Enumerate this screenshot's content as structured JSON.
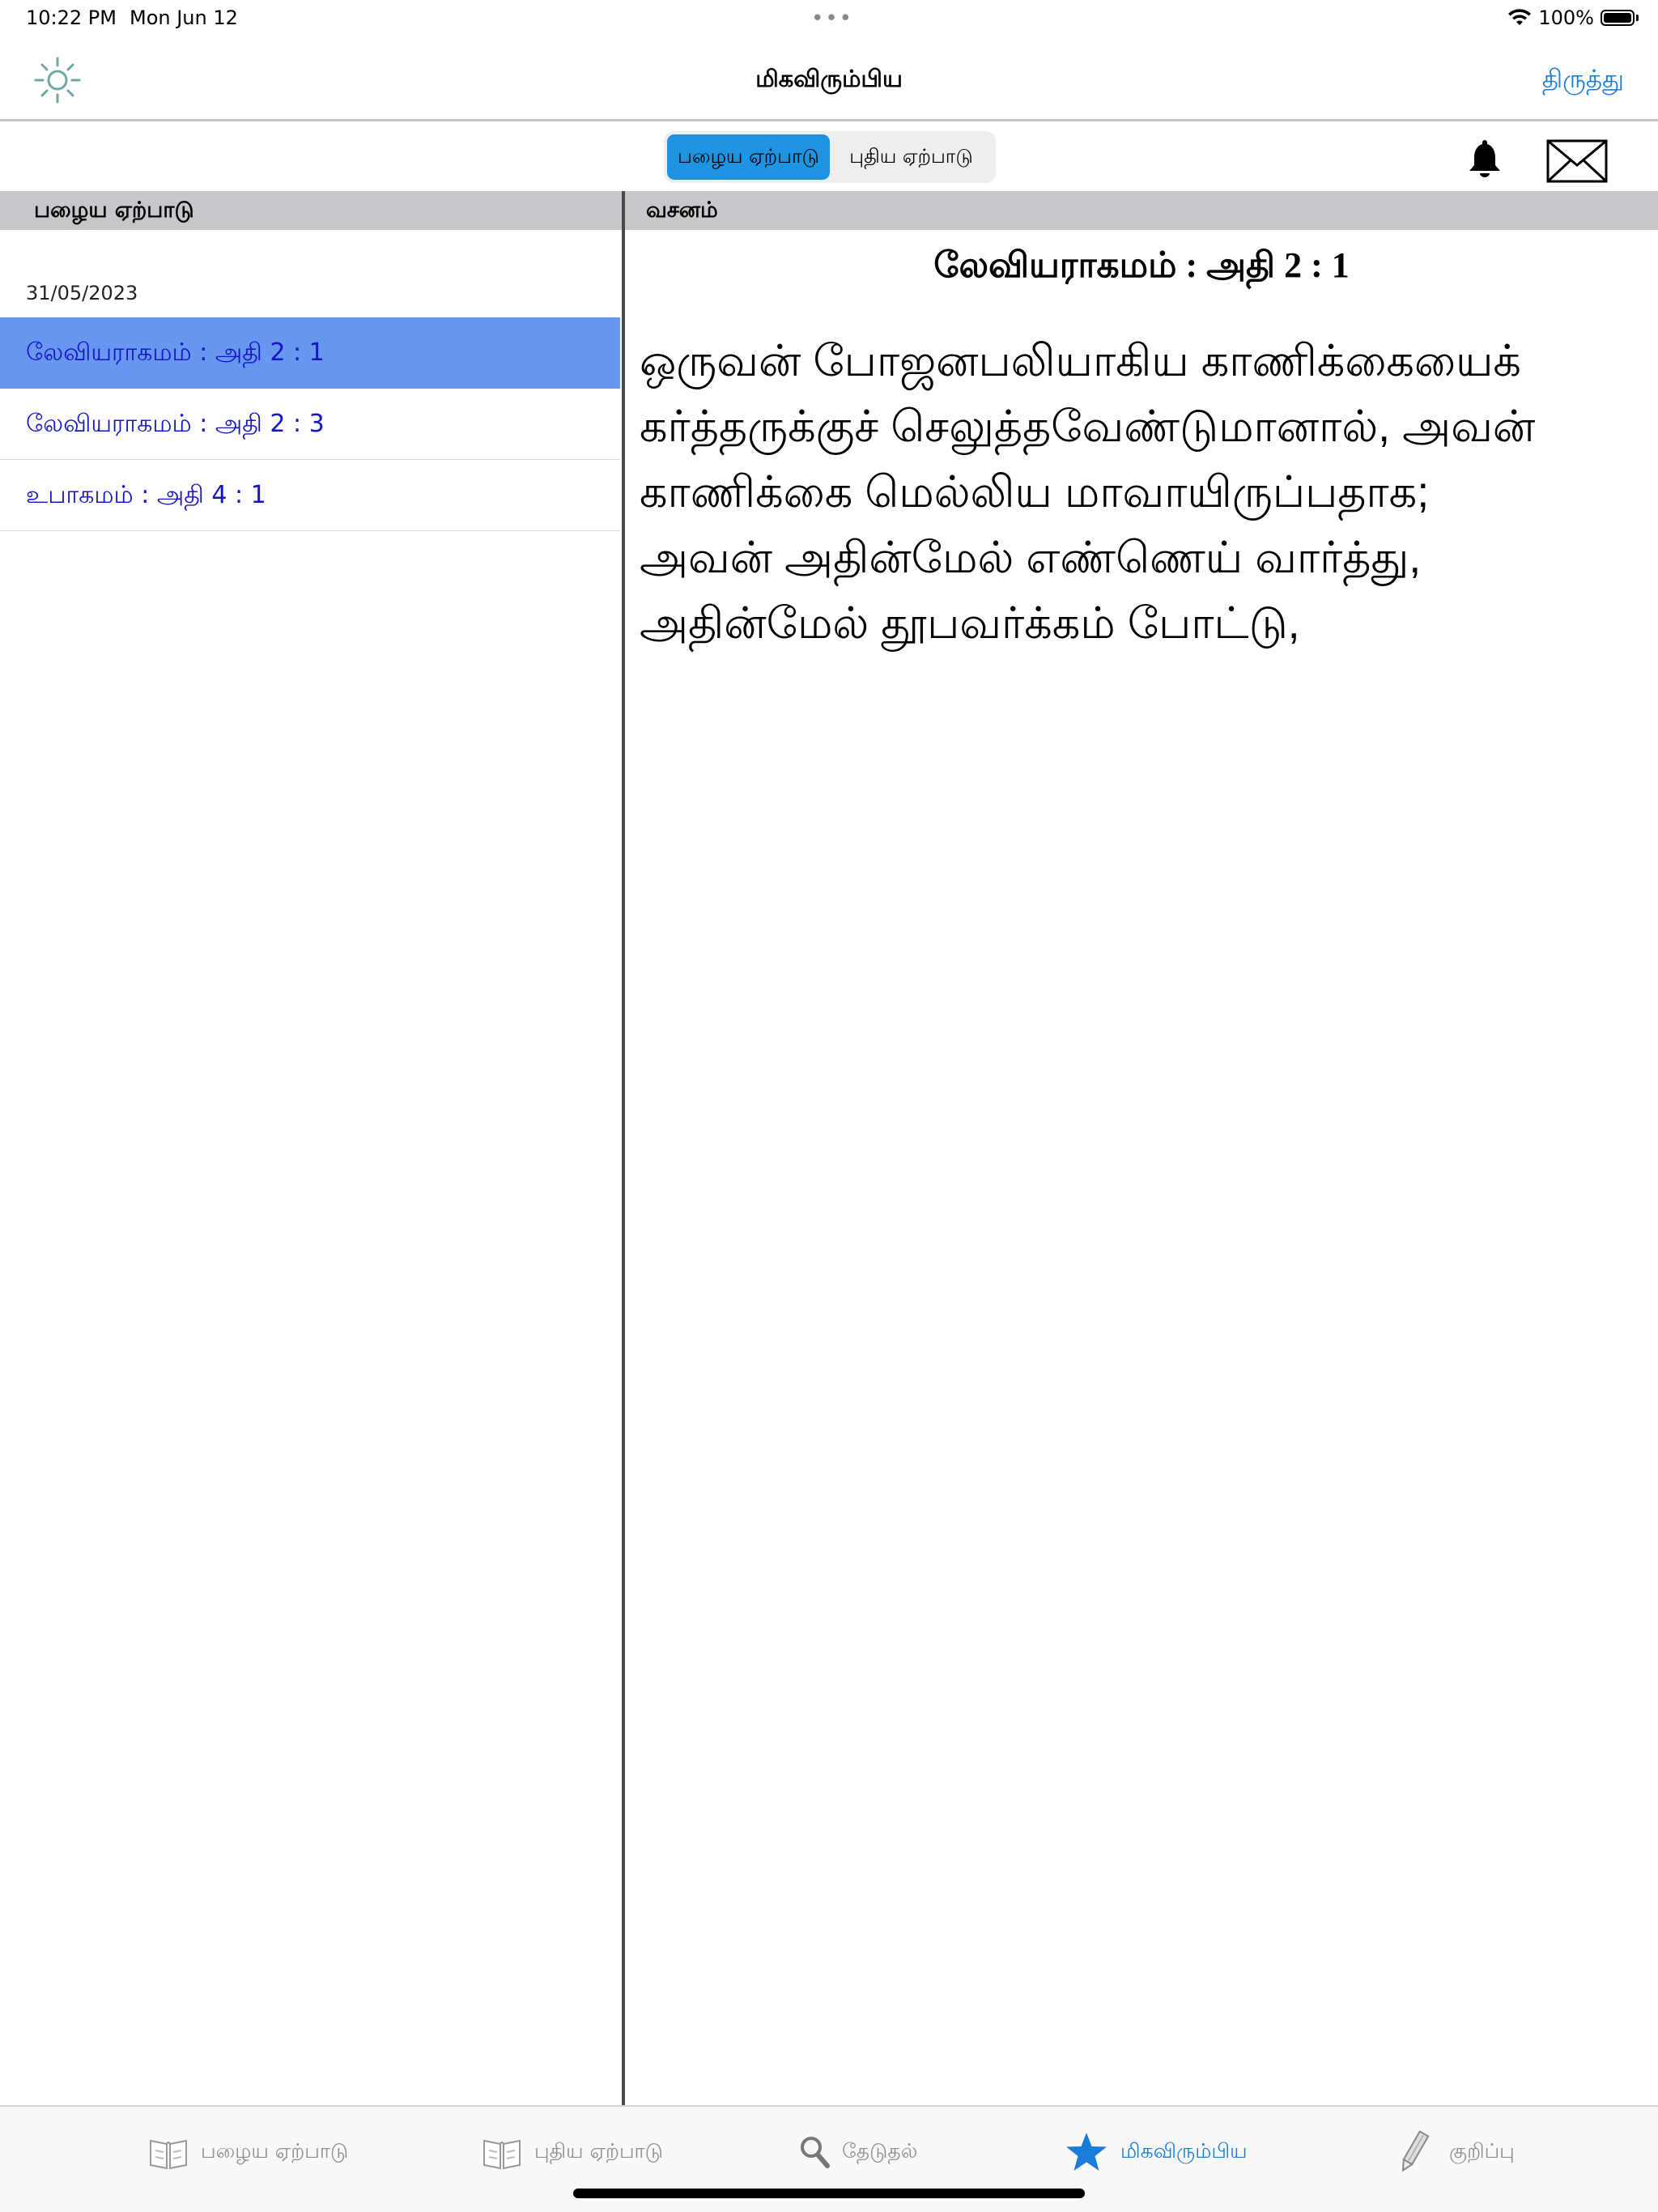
{
  "status_bar": {
    "time": "10:22 PM",
    "date": "Mon Jun 12",
    "dots": "•••",
    "battery_percent": "100%",
    "battery_level": 1.0
  },
  "nav": {
    "title": "மிகவிரும்பிய",
    "edit_label": "திருத்து"
  },
  "segments": {
    "old": "பழைய ஏற்பாடு",
    "new": "புதிய ஏற்பாடு",
    "selected": "old"
  },
  "left_pane": {
    "header": "பழைய ஏற்பாடு",
    "date": "31/05/2023",
    "items": [
      {
        "label": "லேவியராகமம் : அதி 2 : 1",
        "selected": true
      },
      {
        "label": "லேவியராகமம் : அதி 2 : 3",
        "selected": false
      },
      {
        "label": "உபாகமம் : அதி 4 : 1",
        "selected": false
      }
    ]
  },
  "right_pane": {
    "header": "வசனம்",
    "reference": "லேவியராகமம் : அதி 2 : 1",
    "lines": [
      "ஒருவன் போஜனபலியாகிய காணிக்கையைக்",
      "கர்த்தருக்குச் செலுத்தவேண்டுமானால், அவன்",
      "காணிக்கை மெல்லிய மாவாயிருப்பதாக;",
      "அவன் அதின்மேல் எண்ணெய் வார்த்து,",
      "அதின்மேல் தூபவர்க்கம் போட்டு,"
    ]
  },
  "tab_bar": {
    "tabs": [
      {
        "label": "பழைய ஏற்பாடு",
        "icon": "book-icon"
      },
      {
        "label": "புதிய ஏற்பாடு",
        "icon": "book-icon"
      },
      {
        "label": "தேடுதல்",
        "icon": "search-icon"
      },
      {
        "label": "மிகவிரும்பிய",
        "icon": "star-icon"
      },
      {
        "label": "குறிப்பு",
        "icon": "pencil-icon"
      }
    ],
    "active_index": 3
  },
  "colors": {
    "accent": "#1a7cd8",
    "segment_active": "#1e93e2",
    "selected_row": "#6897f0",
    "header_bar": "#c6c6cb",
    "link_text": "#1515c8"
  }
}
